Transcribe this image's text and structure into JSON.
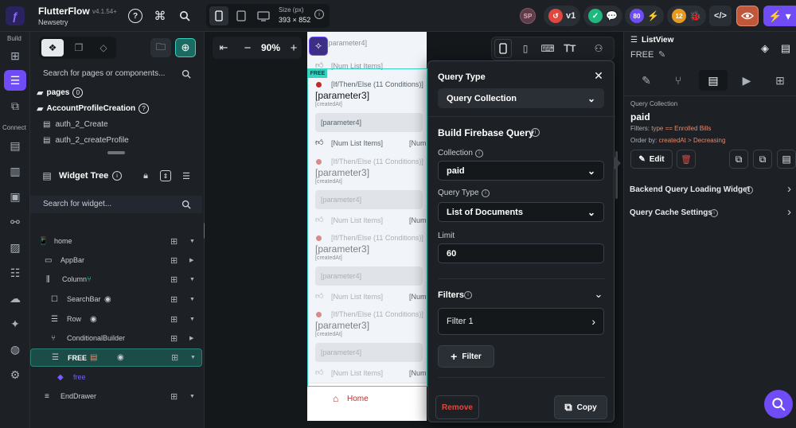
{
  "topbar": {
    "app_name": "FlutterFlow",
    "version": "v4.1.54+",
    "project": "Newsetry",
    "size_label": "Size (px)",
    "size_value": "393 × 852",
    "user_initials": "SP",
    "version_badge": "v1",
    "credit_count": "80",
    "issues_count": "12"
  },
  "rail": {
    "build_label": "Build",
    "connect_label": "Connect"
  },
  "nav": {
    "search_placeholder": "Search for pages or components...",
    "pages_label": "pages",
    "pages_count": "0",
    "folder_label": "AccountProfileCreation",
    "items": [
      "auth_2_Create",
      "auth_2_createProfile"
    ]
  },
  "widget_tree": {
    "title": "Widget Tree",
    "search_placeholder": "Search for widget...",
    "rows": [
      {
        "label": "home",
        "indent": 0,
        "icon": "📱"
      },
      {
        "label": "AppBar",
        "indent": 1,
        "icon": "▭"
      },
      {
        "label": "Column",
        "indent": 1,
        "icon": "⫼"
      },
      {
        "label": "SearchBar",
        "indent": 2,
        "icon": "☐"
      },
      {
        "label": "Row",
        "indent": 2,
        "icon": "☰"
      },
      {
        "label": "ConditionalBuilder",
        "indent": 2,
        "icon": "⑂"
      },
      {
        "label": "FREE",
        "indent": 2,
        "icon": "☰"
      },
      {
        "label": "free",
        "indent": 3,
        "icon": "◆"
      },
      {
        "label": "EndDrawer",
        "indent": 1,
        "icon": "≡"
      }
    ]
  },
  "canvas": {
    "zoom": "90%",
    "free_badge": "FREE"
  },
  "phone": {
    "top_param": "[parameter4]",
    "top_num": "[Num List Items]",
    "cards": [
      {
        "cond": "[If/Then/Else (11 Conditions)]",
        "param3": "[parameter3]",
        "created": "[createdAt]",
        "param4": "[parameter4]",
        "num": "[Num List Items]",
        "num2": "[Num"
      },
      {
        "cond": "[If/Then/Else (11 Conditions)]",
        "param3": "[parameter3]",
        "created": "[createdAt]",
        "param4": "[parameter4]",
        "num": "[Num List Items]",
        "num2": "[Num"
      },
      {
        "cond": "[If/Then/Else (11 Conditions)]",
        "param3": "[parameter3]",
        "created": "[createdAt]",
        "param4": "[parameter4]",
        "num": "[Num List Items]",
        "num2": "[Num"
      },
      {
        "cond": "[If/Then/Else (11 Conditions)]",
        "param3": "[parameter3]",
        "created": "[createdAt]",
        "param4": "[parameter4]",
        "num": "[Num List Items]",
        "num2": "[Num"
      }
    ],
    "home_label": "Home"
  },
  "modal": {
    "title": "Query Type",
    "query_type_value": "Query Collection",
    "section_title": "Build Firebase Query",
    "collection_label": "Collection",
    "collection_value": "paid",
    "query_type_label": "Query Type",
    "query_type2_value": "List of Documents",
    "limit_label": "Limit",
    "limit_value": "60",
    "filters_label": "Filters",
    "filter1": "Filter 1",
    "add_filter": "Filter",
    "remove": "Remove",
    "copy": "Copy"
  },
  "right": {
    "widget_type": "ListView",
    "widget_name": "FREE",
    "qc_label": "Query Collection",
    "qc_value": "paid",
    "filters_prefix": "Filters:",
    "filters_value": "type == Enrolled Bills",
    "order_prefix": "Order by:",
    "order_value": "createdAt > Decreasing",
    "edit_label": "Edit",
    "backend_label": "Backend Query Loading Widget",
    "cache_label": "Query Cache Settings"
  },
  "colors": {
    "accent": "#39d2c0",
    "purple": "#6f4cf6",
    "danger": "#e0473e"
  }
}
